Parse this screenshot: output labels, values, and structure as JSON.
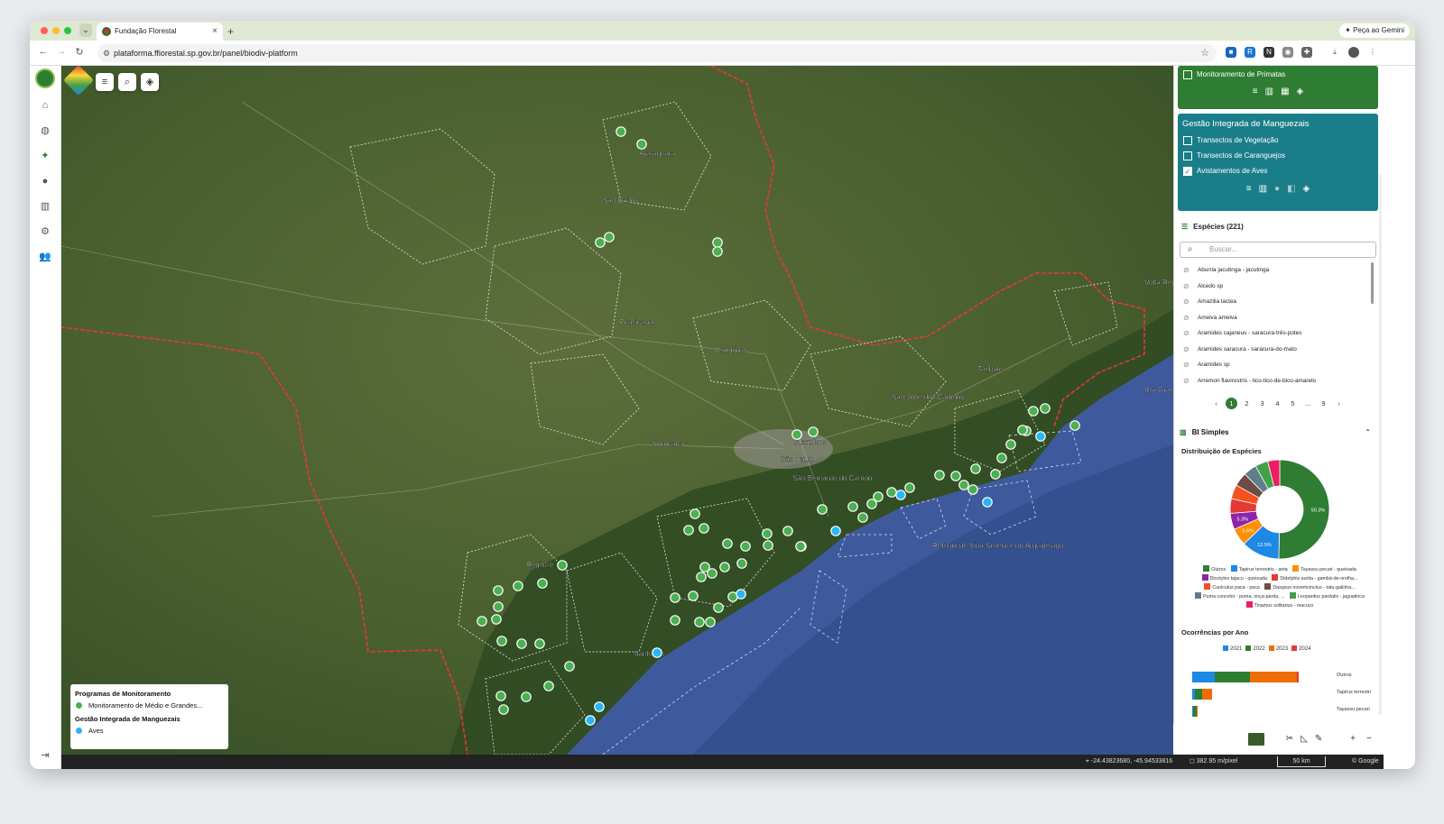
{
  "browser": {
    "tab_title": "Fundação Florestal",
    "new_tab": "+",
    "gemini_label": "✦ Peça ao Gemini",
    "url": "plataforma.ffiorestal.sp.gov.br/panel/biodiv-platform"
  },
  "map": {
    "city_labels": [
      {
        "text": "São Carlos",
        "x": 600,
        "y": 152
      },
      {
        "text": "Campinas",
        "x": 725,
        "y": 318
      },
      {
        "text": "Piracicaba",
        "x": 618,
        "y": 287
      },
      {
        "text": "Sorocaba",
        "x": 655,
        "y": 422
      },
      {
        "text": "Guarulhos",
        "x": 810,
        "y": 420
      },
      {
        "text": "São Paulo",
        "x": 797,
        "y": 439
      },
      {
        "text": "São Bernardo do Campo",
        "x": 810,
        "y": 460
      },
      {
        "text": "São José dos Campos",
        "x": 920,
        "y": 370
      },
      {
        "text": "Taubaté",
        "x": 1015,
        "y": 339
      },
      {
        "text": "Araraquara",
        "x": 640,
        "y": 100
      },
      {
        "text": "Volta Redonda",
        "x": 1200,
        "y": 243
      },
      {
        "text": "Ilha Grande",
        "x": 1200,
        "y": 362
      },
      {
        "text": "Refúgio de Vida Silvestre do Arquipélago",
        "x": 965,
        "y": 535
      },
      {
        "text": "Registro",
        "x": 515,
        "y": 556
      },
      {
        "text": "Itanhaém",
        "x": 635,
        "y": 655
      }
    ],
    "mgm_points": [
      [
        620,
        73
      ],
      [
        643,
        87
      ],
      [
        597,
        196
      ],
      [
        607,
        190
      ],
      [
        727,
        196
      ],
      [
        727,
        206
      ],
      [
        815,
        409
      ],
      [
        833,
        406
      ],
      [
        843,
        492
      ],
      [
        877,
        489
      ],
      [
        888,
        501
      ],
      [
        898,
        486
      ],
      [
        905,
        478
      ],
      [
        920,
        473
      ],
      [
        940,
        468
      ],
      [
        973,
        454
      ],
      [
        991,
        455
      ],
      [
        1000,
        465
      ],
      [
        1013,
        447
      ],
      [
        1010,
        470
      ],
      [
        702,
        497
      ],
      [
        712,
        513
      ],
      [
        695,
        515
      ],
      [
        738,
        530
      ],
      [
        758,
        533
      ],
      [
        782,
        519
      ],
      [
        805,
        516
      ],
      [
        820,
        533
      ],
      [
        783,
        532
      ],
      [
        819,
        533
      ],
      [
        713,
        556
      ],
      [
        721,
        563
      ],
      [
        709,
        567
      ],
      [
        735,
        556
      ],
      [
        754,
        552
      ],
      [
        555,
        554
      ],
      [
        484,
        582
      ],
      [
        506,
        577
      ],
      [
        533,
        574
      ],
      [
        484,
        600
      ],
      [
        482,
        614
      ],
      [
        466,
        616
      ],
      [
        488,
        638
      ],
      [
        510,
        641
      ],
      [
        530,
        641
      ],
      [
        680,
        590
      ],
      [
        700,
        588
      ],
      [
        744,
        589
      ],
      [
        728,
        601
      ],
      [
        680,
        615
      ],
      [
        707,
        617
      ],
      [
        719,
        617
      ],
      [
        563,
        666
      ],
      [
        540,
        688
      ],
      [
        515,
        700
      ],
      [
        487,
        699
      ],
      [
        490,
        714
      ],
      [
        1077,
        383
      ],
      [
        1090,
        380
      ],
      [
        1069,
        405
      ],
      [
        1052,
        420
      ],
      [
        1123,
        399
      ],
      [
        1042,
        435
      ],
      [
        1035,
        453
      ],
      [
        1065,
        404
      ]
    ],
    "aves_points": [
      [
        1085,
        411
      ],
      [
        930,
        476
      ],
      [
        1026,
        484
      ],
      [
        858,
        516
      ],
      [
        753,
        586
      ],
      [
        660,
        651
      ],
      [
        596,
        711
      ],
      [
        586,
        726
      ]
    ],
    "legend": {
      "title1": "Programas de Monitoramento",
      "item1": "Monitoramento de Médio e Grandes...",
      "title2": "Gestão Integrada de Manguezais",
      "item2": "Aves"
    },
    "status": {
      "coords": "-24.43823680, -45.94533816",
      "resolution": "382.95 m/pixel",
      "scale": "50 km",
      "attribution": "© Google"
    }
  },
  "panel": {
    "primatas_label": "Monitoramento de Primatas",
    "gim_title": "Gestão Integrada de Manguezais",
    "gim_items": [
      {
        "label": "Transectos de Vegetação",
        "checked": false
      },
      {
        "label": "Transectos de Caranguejos",
        "checked": false
      },
      {
        "label": "Avistamentos de Aves",
        "checked": true
      }
    ],
    "species_title": "Espécies (221)",
    "search_placeholder": "Buscar...",
    "species": [
      "Aburria jacutinga - jacutinga",
      "Alcedo sp",
      "Amazilia lactea",
      "Ameiva ameiva",
      "Aramides cajaneus - saracura-três-potes",
      "Aramides saracura - saracura-do-mato",
      "Aramides sp",
      "Arremon flavirostris - tico-tico-de-bico-amarelo"
    ],
    "pages": [
      "‹",
      "1",
      "2",
      "3",
      "4",
      "5",
      "...",
      "9",
      "›"
    ],
    "bi_title": "BI Simples",
    "dist_title": "Distribuição de Espécies",
    "occ_title": "Ocorrências por Ano",
    "pie_legend": [
      {
        "label": "Outros",
        "color": "#2e7d32"
      },
      {
        "label": "Tapirus terrestris - anta",
        "color": "#1e88e5"
      },
      {
        "label": "Tayassu pecari - queixada",
        "color": "#ff8f00"
      },
      {
        "label": "Dicotyles tajacu - queixada",
        "color": "#8e24aa"
      },
      {
        "label": "Didelphis aurita - gambá-de-orelha...",
        "color": "#e53935"
      },
      {
        "label": "Cuniculus paca - paca",
        "color": "#f4511e"
      },
      {
        "label": "Dasypus novemcinctus - tatu-galinha...",
        "color": "#6d4c41"
      },
      {
        "label": "Puma concolor - puma, onça-parda, ...",
        "color": "#607d8b"
      },
      {
        "label": "Leopardus pardalis - jaguatirica",
        "color": "#43a047"
      },
      {
        "label": "Tinamus solitarius - macuco",
        "color": "#e91e63"
      }
    ],
    "year_legend": [
      {
        "label": "2021",
        "color": "#1e88e5"
      },
      {
        "label": "2022",
        "color": "#2e7d32"
      },
      {
        "label": "2023",
        "color": "#ef6c00"
      },
      {
        "label": "2024",
        "color": "#e53935"
      }
    ]
  },
  "chart_data": [
    {
      "type": "pie",
      "title": "Distribuição de Espécies",
      "categories": [
        "Outros",
        "Tapirus terrestris - anta",
        "Tayassu pecari - queixada",
        "Dicotyles tajacu - queixada",
        "Didelphis aurita - gambá-de-orelha...",
        "Cuniculus paca - paca",
        "Dasypus novemcinctus - tatu-galinha...",
        "Puma concolor - puma, onça-parda, ...",
        "Leopardus pardalis - jaguatirica",
        "Tinamus solitarius - macuco"
      ],
      "values": [
        50.3,
        12.5,
        5.6,
        5.3,
        4.8,
        4.6,
        4.5,
        4.3,
        4.2,
        3.9
      ],
      "data_labels": [
        "50.3%",
        "12.5%",
        "5.6%",
        "5.3%",
        "",
        "",
        "",
        "",
        "",
        ""
      ]
    },
    {
      "type": "bar",
      "title": "Ocorrências por Ano",
      "categories": [
        "Outros",
        "Tapirus terrestri",
        "Tayassu pecari"
      ],
      "series": [
        {
          "name": "2021",
          "values": [
            28,
            3,
            1
          ]
        },
        {
          "name": "2022",
          "values": [
            44,
            9,
            5
          ]
        },
        {
          "name": "2023",
          "values": [
            58,
            13,
            1
          ]
        },
        {
          "name": "2024",
          "values": [
            2,
            0,
            0
          ]
        }
      ]
    }
  ]
}
